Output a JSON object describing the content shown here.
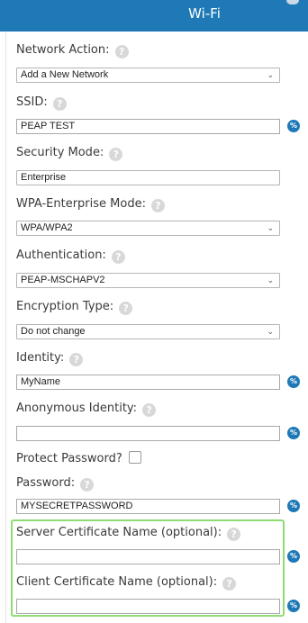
{
  "header": {
    "title": "Wi-Fi"
  },
  "help_glyph": "?",
  "field_action_glyph": "%",
  "caret_glyph": "⌄",
  "form": {
    "network_action": {
      "label": "Network Action:",
      "value": "Add a New Network"
    },
    "ssid": {
      "label": "SSID:",
      "value": "PEAP TEST"
    },
    "security_mode": {
      "label": "Security Mode:",
      "value": "Enterprise"
    },
    "wpa_mode": {
      "label": "WPA-Enterprise Mode:",
      "value": "WPA/WPA2"
    },
    "authentication": {
      "label": "Authentication:",
      "value": "PEAP-MSCHAPV2"
    },
    "encryption": {
      "label": "Encryption Type:",
      "value": "Do not change"
    },
    "identity": {
      "label": "Identity:",
      "value": "MyName"
    },
    "anon_identity": {
      "label": "Anonymous Identity:",
      "value": ""
    },
    "protect_password": {
      "label": "Protect Password?",
      "checked": false
    },
    "password": {
      "label": "Password:",
      "value": "MYSECRETPASSWORD"
    },
    "server_cert": {
      "label": "Server Certificate Name (optional):",
      "value": ""
    },
    "client_cert": {
      "label": "Client Certificate Name (optional):",
      "value": ""
    }
  },
  "colors": {
    "header_bg": "#1e79b6",
    "action_button": "#1e79b6",
    "highlight_border": "#8fdc74",
    "help_icon": "#d8d8d8"
  }
}
